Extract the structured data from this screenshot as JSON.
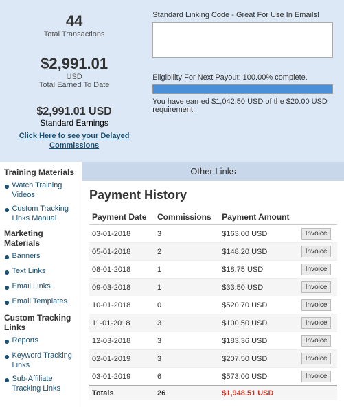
{
  "stats": {
    "total_transactions": "44",
    "total_transactions_label": "Total Transactions",
    "total_earned": "$2,991.01",
    "total_earned_currency": "USD",
    "total_earned_label": "Total Earned To Date",
    "standard_earnings": "$2,991.01 USD",
    "standard_earnings_label": "Standard Earnings",
    "delayed_link": "Click Here to see your Delayed Commissions"
  },
  "linking_code": {
    "title": "Standard Linking Code - Great For Use In Emails!",
    "placeholder": ""
  },
  "eligibility": {
    "title": "Eligibility For Next Payout: 100.00% complete.",
    "progress_percent": 100,
    "desc": "You have earned $1,042.50 USD of the $20.00 USD requirement."
  },
  "sidebar": {
    "training_title": "Training Materials",
    "training_items": [
      {
        "label": "Watch Training Videos",
        "bullet": "●"
      },
      {
        "label": "Custom Tracking Links Manual",
        "bullet": "●"
      }
    ],
    "marketing_title": "Marketing Materials",
    "marketing_items": [
      {
        "label": "Banners",
        "bullet": "●"
      },
      {
        "label": "Text Links",
        "bullet": "●"
      },
      {
        "label": "Email Links",
        "bullet": "●"
      },
      {
        "label": "Email Templates",
        "bullet": "●"
      }
    ],
    "custom_title": "Custom Tracking Links",
    "custom_items": [
      {
        "label": "Reports",
        "bullet": "●"
      },
      {
        "label": "Keyword Tracking Links",
        "bullet": "●"
      },
      {
        "label": "Sub-Affiliate Tracking Links",
        "bullet": "●"
      }
    ]
  },
  "content": {
    "other_links_label": "Other Links",
    "payment_history_title": "Payment History",
    "table_headers": [
      "Payment Date",
      "Commissions",
      "Payment Amount",
      ""
    ],
    "rows": [
      {
        "date": "03-01-2018",
        "commissions": "3",
        "amount": "$163.00 USD",
        "invoice": "Invoice"
      },
      {
        "date": "05-01-2018",
        "commissions": "2",
        "amount": "$148.20 USD",
        "invoice": "Invoice"
      },
      {
        "date": "08-01-2018",
        "commissions": "1",
        "amount": "$18.75 USD",
        "invoice": "Invoice"
      },
      {
        "date": "09-03-2018",
        "commissions": "1",
        "amount": "$33.50 USD",
        "invoice": "Invoice"
      },
      {
        "date": "10-01-2018",
        "commissions": "0",
        "amount": "$520.70 USD",
        "invoice": "Invoice"
      },
      {
        "date": "11-01-2018",
        "commissions": "3",
        "amount": "$100.50 USD",
        "invoice": "Invoice"
      },
      {
        "date": "12-03-2018",
        "commissions": "3",
        "amount": "$183.36 USD",
        "invoice": "Invoice"
      },
      {
        "date": "02-01-2019",
        "commissions": "3",
        "amount": "$207.50 USD",
        "invoice": "Invoice"
      },
      {
        "date": "03-01-2019",
        "commissions": "6",
        "amount": "$573.00 USD",
        "invoice": "Invoice"
      }
    ],
    "totals_label": "Totals",
    "totals_commissions": "26",
    "totals_amount": "$1,948.51 USD"
  }
}
